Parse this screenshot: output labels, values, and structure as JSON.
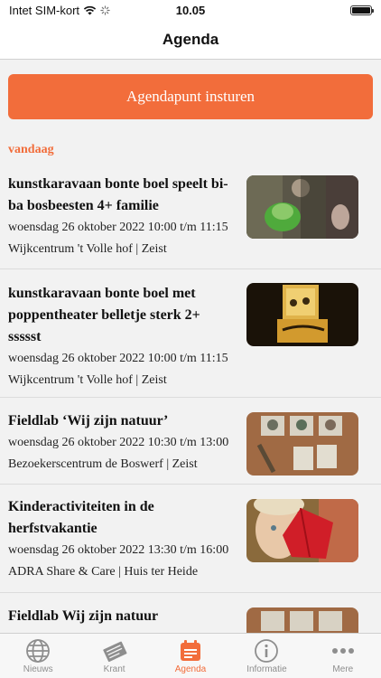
{
  "status_bar": {
    "carrier": "Intet SIM-kort",
    "time": "10.05"
  },
  "nav": {
    "title": "Agenda"
  },
  "submit_button": {
    "label": "Agendapunt insturen"
  },
  "section": {
    "label": "vandaag"
  },
  "events": [
    {
      "title_lines": [
        "kunstkaravaan bonte boel speelt bi-",
        "ba bosbeesten 4+ familie"
      ],
      "date": "woensdag 26 oktober 2022 10:00 t/m 11:15",
      "place": "Wijkcentrum 't Volle hof | Zeist"
    },
    {
      "title_lines": [
        "kunstkaravaan bonte boel met",
        "poppentheater belletje sterk 2+",
        "ssssst"
      ],
      "date": "woensdag 26 oktober 2022 10:00 t/m 11:15",
      "place": "Wijkcentrum 't Volle hof | Zeist"
    },
    {
      "title_lines": [
        "Fieldlab ‘Wij zijn natuur’"
      ],
      "date": "woensdag 26 oktober 2022 10:30 t/m 13:00",
      "place": "Bezoekerscentrum de Boswerf | Zeist"
    },
    {
      "title_lines": [
        "Kinderactiviteiten in de",
        "herfstvakantie"
      ],
      "date": "woensdag 26 oktober 2022 13:30 t/m 16:00",
      "place": "ADRA Share & Care | Huis ter Heide"
    },
    {
      "title_lines": [
        "Fieldlab Wij zijn natuur"
      ],
      "date": "",
      "place": ""
    }
  ],
  "tabs": [
    {
      "label": "Nieuws",
      "icon": "globe-icon"
    },
    {
      "label": "Krant",
      "icon": "newspaper-icon"
    },
    {
      "label": "Agenda",
      "icon": "calendar-icon",
      "active": true
    },
    {
      "label": "Informatie",
      "icon": "info-icon"
    },
    {
      "label": "Mere",
      "icon": "more-icon"
    }
  ],
  "colors": {
    "accent": "#f26d3b",
    "inactive": "#8e8e8e"
  }
}
